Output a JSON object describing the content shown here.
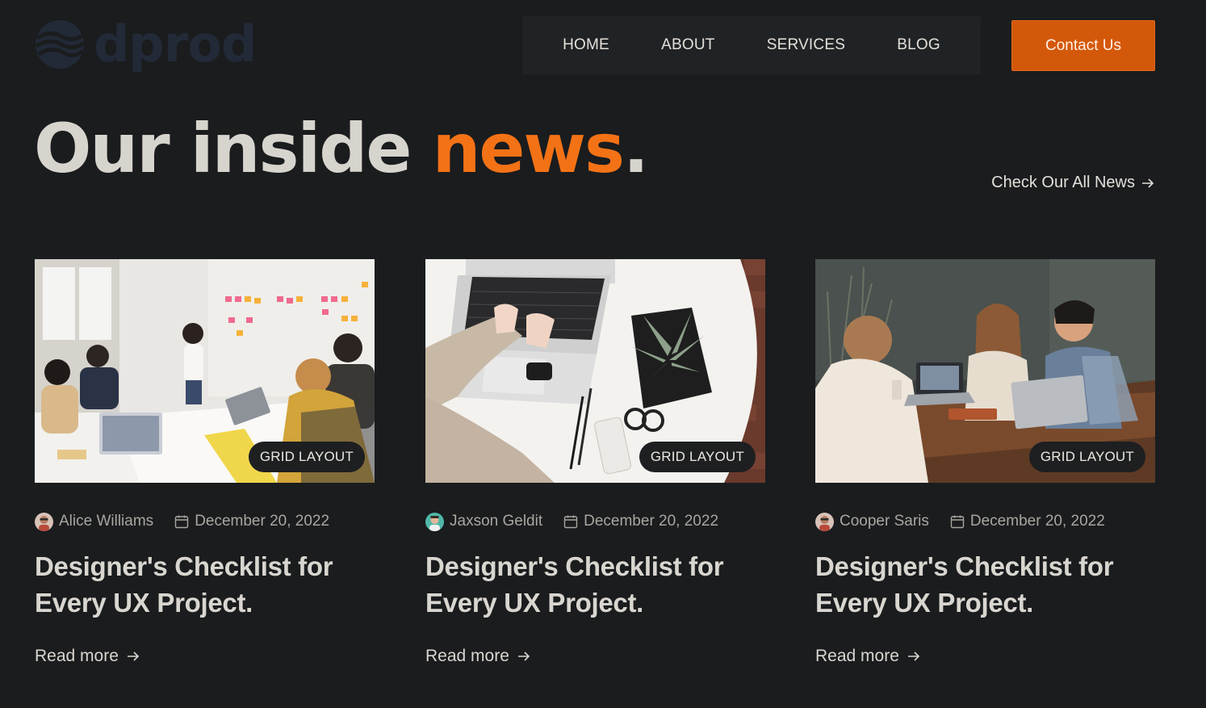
{
  "brand": {
    "logo_text": "dprod",
    "accent_color": "#f47216",
    "button_color": "#d4580a"
  },
  "nav": {
    "items": [
      {
        "label": "HOME"
      },
      {
        "label": "ABOUT"
      },
      {
        "label": "SERVICES"
      },
      {
        "label": "BLOG"
      }
    ],
    "contact_label": "Contact Us"
  },
  "section": {
    "title_main": "Our inside ",
    "title_accent": "news",
    "title_end": ".",
    "all_news_label": "Check Our All News",
    "all_news_icon": "arrow-right-icon"
  },
  "posts": [
    {
      "tag": "GRID LAYOUT",
      "author": "Alice Williams",
      "date": "December 20, 2022",
      "title": "Designer's Checklist for Every UX Project.",
      "read_more": "Read more",
      "image": "team-meeting-whiteboard-photo"
    },
    {
      "tag": "GRID LAYOUT",
      "author": "Jaxson Geldit",
      "date": "December 20, 2022",
      "title": "Designer's Checklist for Every UX Project.",
      "read_more": "Read more",
      "image": "laptop-typing-desk-photo"
    },
    {
      "tag": "GRID LAYOUT",
      "author": "Cooper Saris",
      "date": "December 20, 2022",
      "title": "Designer's Checklist for Every UX Project.",
      "read_more": "Read more",
      "image": "friends-cafe-laptops-photo"
    }
  ]
}
